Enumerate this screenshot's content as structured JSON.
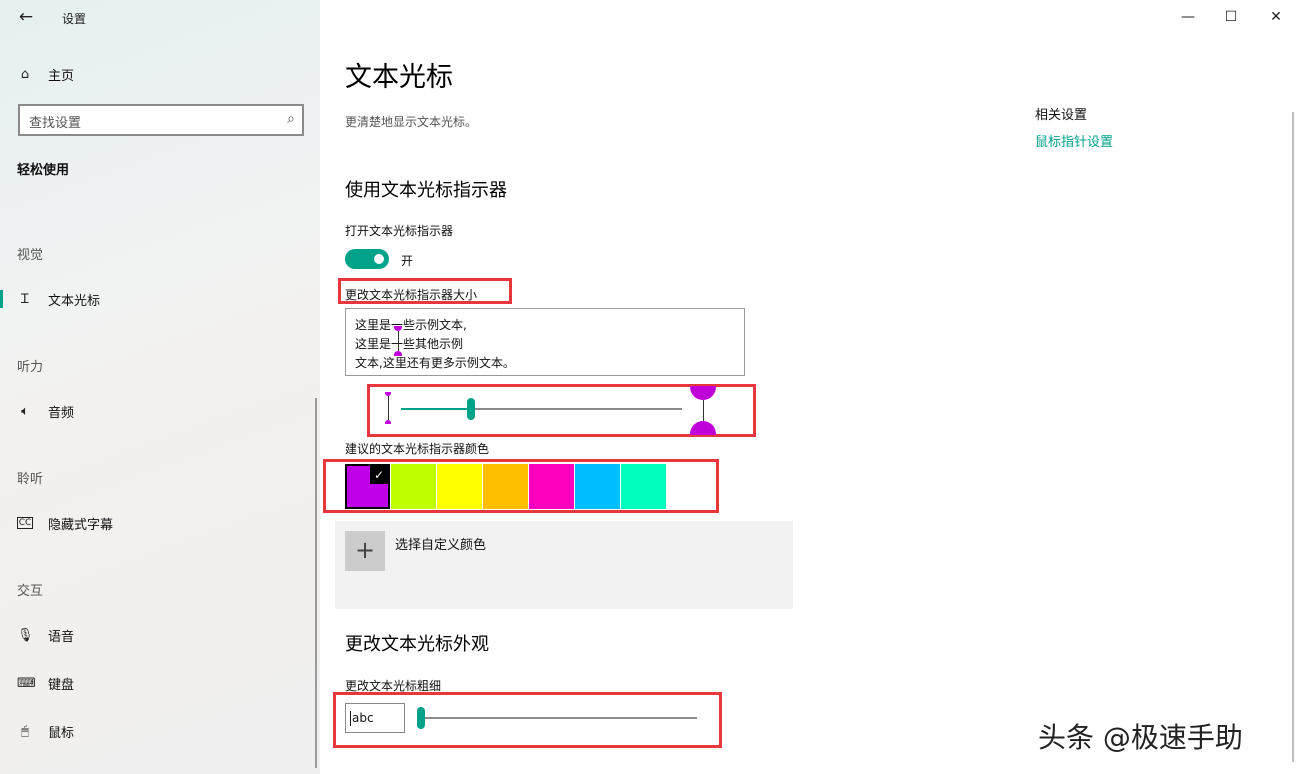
{
  "window": {
    "title": "设置",
    "minimize_icon": "minimize-icon",
    "maximize_icon": "maximize-icon",
    "close_icon": "close-icon"
  },
  "sidebar": {
    "home_label": "主页",
    "search_placeholder": "查找设置",
    "section_heading": "轻松使用",
    "categories": {
      "vision": "视觉",
      "hearing": "听力",
      "listening": "聆听",
      "interaction": "交互"
    },
    "items": [
      {
        "label": "文本光标",
        "icon": "text-cursor-icon",
        "active": true
      },
      {
        "label": "音频",
        "icon": "speaker-icon"
      },
      {
        "label": "隐藏式字幕",
        "icon": "closed-caption-icon"
      },
      {
        "label": "语音",
        "icon": "microphone-icon"
      },
      {
        "label": "键盘",
        "icon": "keyboard-icon"
      },
      {
        "label": "鼠标",
        "icon": "mouse-icon"
      }
    ]
  },
  "main": {
    "title": "文本光标",
    "subtitle": "更清楚地显示文本光标。",
    "indicator_section": {
      "heading": "使用文本光标指示器",
      "toggle_label": "打开文本光标指示器",
      "toggle_state": "开",
      "toggle_on": true,
      "size_label": "更改文本光标指示器大小",
      "preview_lines": [
        "这里是一些示例文本,",
        "这里是一些其他示例",
        "文本,这里还有更多示例文本。"
      ],
      "size_level": 0.25,
      "color_label": "建议的文本光标指示器颜色",
      "colors": [
        "#bf00e8",
        "#bfff00",
        "#ffff00",
        "#ffbf00",
        "#ff00bf",
        "#00bfff",
        "#00ffbf",
        "#ffffff"
      ],
      "selected_color_index": 0,
      "custom_color_label": "选择自定义颜色"
    },
    "appearance_section": {
      "heading": "更改文本光标外观",
      "thickness_label": "更改文本光标粗细",
      "thickness_preview": "abc",
      "thickness_level": 0.0
    }
  },
  "related": {
    "heading": "相关设置",
    "link": "鼠标指针设置"
  },
  "watermark": "头条 @极速手助",
  "accent_color": "#00a28a",
  "highlight_color": "#e8373c"
}
